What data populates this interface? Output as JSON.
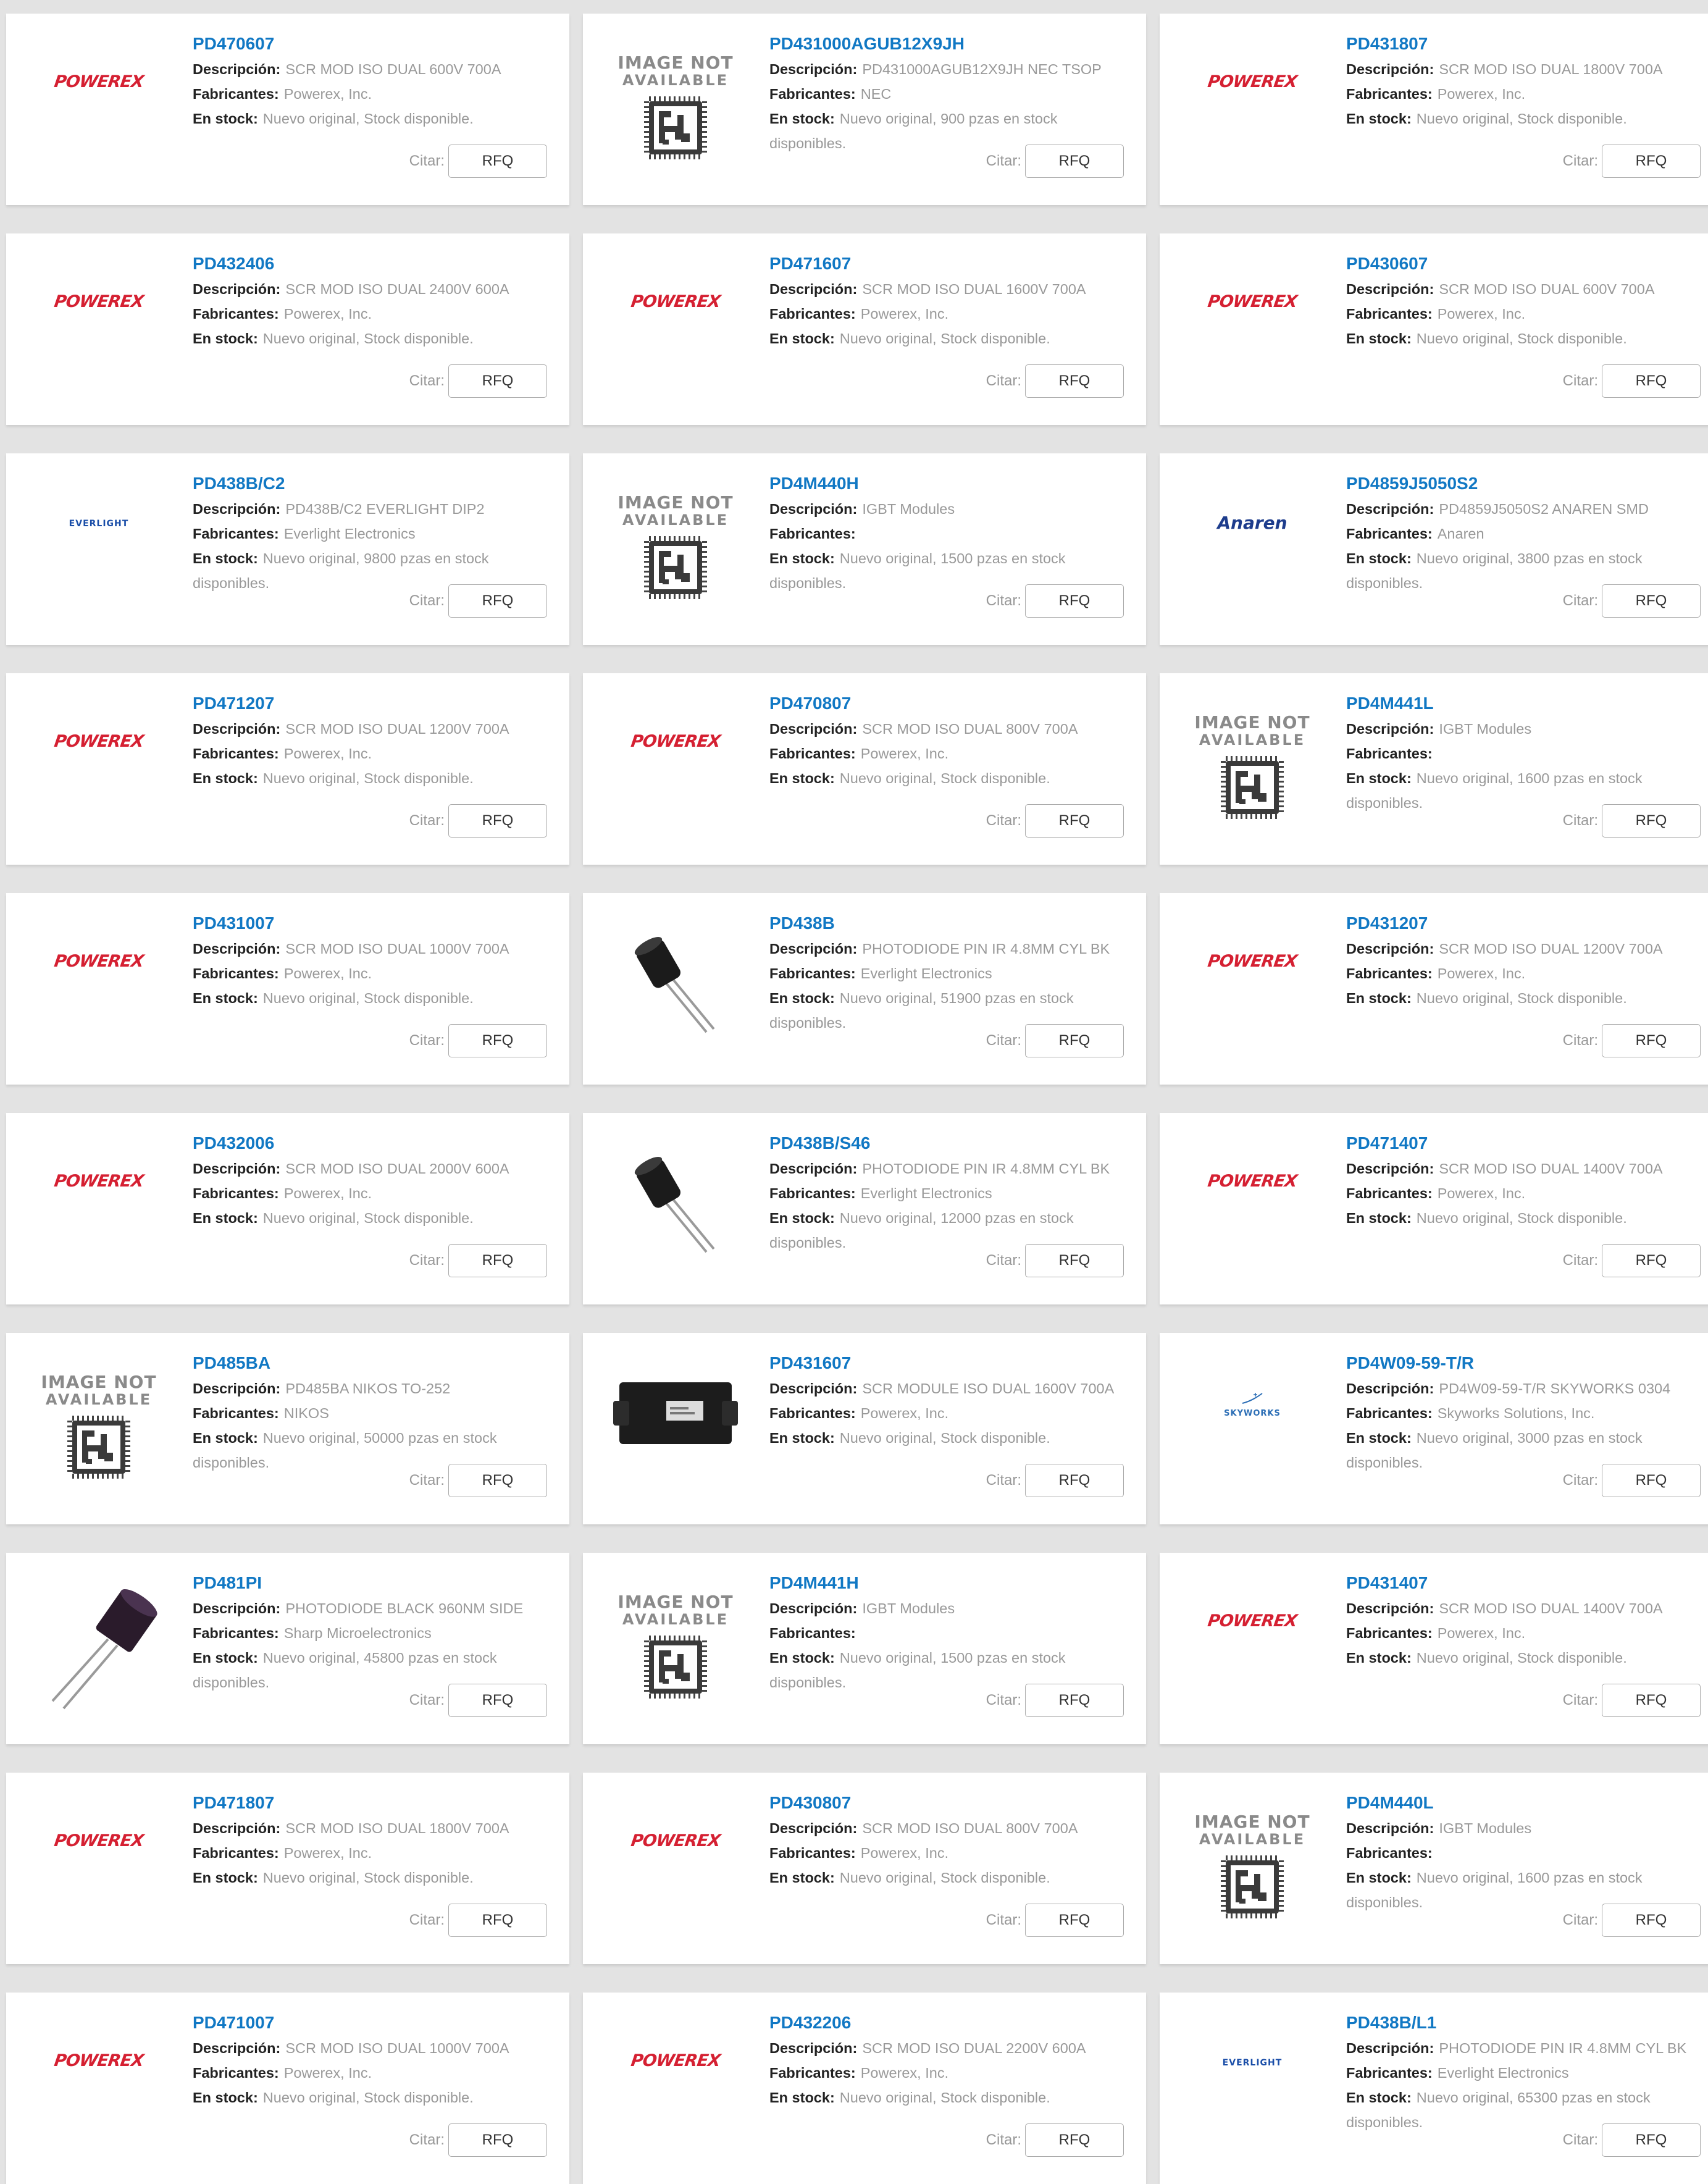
{
  "labels": {
    "description": "Descripción:",
    "manufacturer": "Fabricantes:",
    "stock": "En stock:",
    "quote": "Citar:",
    "rfq": "RFQ"
  },
  "logos": {
    "powerex": "POWEREX",
    "everlight": "EVERLIGHT",
    "anaren": "Anaren",
    "skyworks": "SKYWORKS",
    "image_not_line1": "IMAGE NOT",
    "image_not_line2": "AVAILABLE"
  },
  "products": [
    {
      "part": "PD470607",
      "desc": "SCR MOD ISO DUAL 600V 700A",
      "mfr": "Powerex, Inc.",
      "stock": "Nuevo original, Stock disponible.",
      "image": "powerex-logo"
    },
    {
      "part": "PD431000AGUB12X9JH",
      "desc": "PD431000AGUB12X9JH NEC TSOP",
      "mfr": "NEC",
      "stock": "Nuevo original, 900 pzas en stock disponibles.",
      "image": "image-not-available"
    },
    {
      "part": "PD431807",
      "desc": "SCR MOD ISO DUAL 1800V 700A",
      "mfr": "Powerex, Inc.",
      "stock": "Nuevo original, Stock disponible.",
      "image": "powerex-logo"
    },
    {
      "part": "PD432406",
      "desc": "SCR MOD ISO DUAL 2400V 600A",
      "mfr": "Powerex, Inc.",
      "stock": "Nuevo original, Stock disponible.",
      "image": "powerex-logo"
    },
    {
      "part": "PD471607",
      "desc": "SCR MOD ISO DUAL 1600V 700A",
      "mfr": "Powerex, Inc.",
      "stock": "Nuevo original, Stock disponible.",
      "image": "powerex-logo"
    },
    {
      "part": "PD430607",
      "desc": "SCR MOD ISO DUAL 600V 700A",
      "mfr": "Powerex, Inc.",
      "stock": "Nuevo original, Stock disponible.",
      "image": "powerex-logo"
    },
    {
      "part": "PD438B/C2",
      "desc": "PD438B/C2 EVERLIGHT DIP2",
      "mfr": "Everlight Electronics",
      "stock": "Nuevo original, 9800 pzas en stock disponibles.",
      "image": "everlight-logo"
    },
    {
      "part": "PD4M440H",
      "desc": "IGBT Modules",
      "mfr": "",
      "stock": "Nuevo original, 1500 pzas en stock disponibles.",
      "image": "image-not-available"
    },
    {
      "part": "PD4859J5050S2",
      "desc": "PD4859J5050S2 ANAREN SMD",
      "mfr": "Anaren",
      "stock": "Nuevo original, 3800 pzas en stock disponibles.",
      "image": "anaren-logo"
    },
    {
      "part": "PD471207",
      "desc": "SCR MOD ISO DUAL 1200V 700A",
      "mfr": "Powerex, Inc.",
      "stock": "Nuevo original, Stock disponible.",
      "image": "powerex-logo"
    },
    {
      "part": "PD470807",
      "desc": "SCR MOD ISO DUAL 800V 700A",
      "mfr": "Powerex, Inc.",
      "stock": "Nuevo original, Stock disponible.",
      "image": "powerex-logo"
    },
    {
      "part": "PD4M441L",
      "desc": "IGBT Modules",
      "mfr": "",
      "stock": "Nuevo original, 1600 pzas en stock disponibles.",
      "image": "image-not-available"
    },
    {
      "part": "PD431007",
      "desc": "SCR MOD ISO DUAL 1000V 700A",
      "mfr": "Powerex, Inc.",
      "stock": "Nuevo original, Stock disponible.",
      "image": "powerex-logo"
    },
    {
      "part": "PD438B",
      "desc": "PHOTODIODE PIN IR 4.8MM CYL BK",
      "mfr": "Everlight Electronics",
      "stock": "Nuevo original, 51900 pzas en stock disponibles.",
      "image": "photodiode-cyl"
    },
    {
      "part": "PD431207",
      "desc": "SCR MOD ISO DUAL 1200V 700A",
      "mfr": "Powerex, Inc.",
      "stock": "Nuevo original, Stock disponible.",
      "image": "powerex-logo"
    },
    {
      "part": "PD432006",
      "desc": "SCR MOD ISO DUAL 2000V 600A",
      "mfr": "Powerex, Inc.",
      "stock": "Nuevo original, Stock disponible.",
      "image": "powerex-logo"
    },
    {
      "part": "PD438B/S46",
      "desc": "PHOTODIODE PIN IR 4.8MM CYL BK",
      "mfr": "Everlight Electronics",
      "stock": "Nuevo original, 12000 pzas en stock disponibles.",
      "image": "photodiode-cyl"
    },
    {
      "part": "PD471407",
      "desc": "SCR MOD ISO DUAL 1400V 700A",
      "mfr": "Powerex, Inc.",
      "stock": "Nuevo original, Stock disponible.",
      "image": "powerex-logo"
    },
    {
      "part": "PD485BA",
      "desc": "PD485BA NIKOS TO-252",
      "mfr": "NIKOS",
      "stock": "Nuevo original, 50000 pzas en stock disponibles.",
      "image": "image-not-available"
    },
    {
      "part": "PD431607",
      "desc": "SCR MODULE ISO DUAL 1600V 700A",
      "mfr": "Powerex, Inc.",
      "stock": "Nuevo original, Stock disponible.",
      "image": "scr-module"
    },
    {
      "part": "PD4W09-59-T/R",
      "desc": "PD4W09-59-T/R SKYWORKS 0304",
      "mfr": "Skyworks Solutions, Inc.",
      "stock": "Nuevo original, 3000 pzas en stock disponibles.",
      "image": "skyworks-logo"
    },
    {
      "part": "PD481PI",
      "desc": "PHOTODIODE BLACK 960NM SIDE",
      "mfr": "Sharp Microelectronics",
      "stock": "Nuevo original, 45800 pzas en stock disponibles.",
      "image": "photodiode-side"
    },
    {
      "part": "PD4M441H",
      "desc": "IGBT Modules",
      "mfr": "",
      "stock": "Nuevo original, 1500 pzas en stock disponibles.",
      "image": "image-not-available"
    },
    {
      "part": "PD431407",
      "desc": "SCR MOD ISO DUAL 1400V 700A",
      "mfr": "Powerex, Inc.",
      "stock": "Nuevo original, Stock disponible.",
      "image": "powerex-logo"
    },
    {
      "part": "PD471807",
      "desc": "SCR MOD ISO DUAL 1800V 700A",
      "mfr": "Powerex, Inc.",
      "stock": "Nuevo original, Stock disponible.",
      "image": "powerex-logo"
    },
    {
      "part": "PD430807",
      "desc": "SCR MOD ISO DUAL 800V 700A",
      "mfr": "Powerex, Inc.",
      "stock": "Nuevo original, Stock disponible.",
      "image": "powerex-logo"
    },
    {
      "part": "PD4M440L",
      "desc": "IGBT Modules",
      "mfr": "",
      "stock": "Nuevo original, 1600 pzas en stock disponibles.",
      "image": "image-not-available"
    },
    {
      "part": "PD471007",
      "desc": "SCR MOD ISO DUAL 1000V 700A",
      "mfr": "Powerex, Inc.",
      "stock": "Nuevo original, Stock disponible.",
      "image": "powerex-logo"
    },
    {
      "part": "PD432206",
      "desc": "SCR MOD ISO DUAL 2200V 600A",
      "mfr": "Powerex, Inc.",
      "stock": "Nuevo original, Stock disponible.",
      "image": "powerex-logo"
    },
    {
      "part": "PD438B/L1",
      "desc": "PHOTODIODE PIN IR 4.8MM CYL BK",
      "mfr": "Everlight Electronics",
      "stock": "Nuevo original, 65300 pzas en stock disponibles.",
      "image": "everlight-logo"
    }
  ]
}
